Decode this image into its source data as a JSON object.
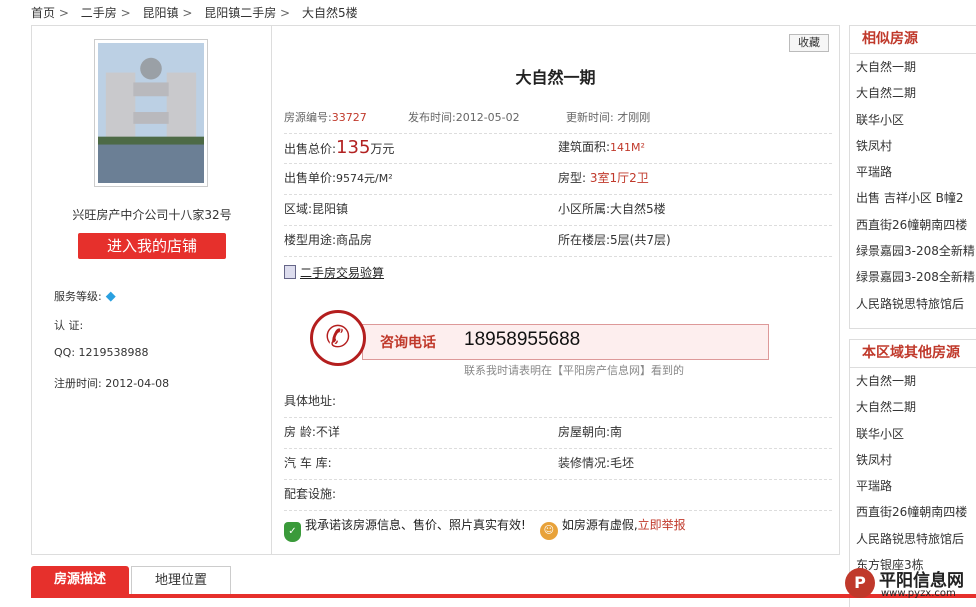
{
  "breadcrumb": [
    "首页",
    "二手房",
    "昆阳镇",
    "昆阳镇二手房",
    "大自然5楼"
  ],
  "breadcrumb_sep": ">",
  "agent": {
    "company": "兴旺房产中介公司十八家32号",
    "shop_button": "进入我的店铺",
    "service_label": "服务等级:",
    "cert_label": "认  证:",
    "qq_label": "QQ:",
    "qq": "1219538988",
    "reg_label": "注册时间:",
    "reg_date": "2012-04-08"
  },
  "listing": {
    "favorite": "收藏",
    "title": "大自然一期",
    "id_label": "房源编号:",
    "id": "33727",
    "publish_label": "发布时间:",
    "publish": "2012-05-02",
    "update_label": "更新时间:",
    "update": "才刚刚",
    "total_label": "出售总价:",
    "total": "135",
    "total_unit": "万元",
    "area_label": "建筑面积:",
    "area": "141M²",
    "unit_price_label": "出售单价:",
    "unit_price": "9574元/M²",
    "layout_label": "房型:",
    "layout": "3室1厅2卫",
    "region_label": "区域:",
    "region": "昆阳镇",
    "community_label": "小区所属:",
    "community": "大自然5楼",
    "use_label": "楼型用途:",
    "use": "商品房",
    "floor_label": "所在楼层:",
    "floor": "5层(共7层)",
    "calc": "二手房交易验算",
    "phone_label": "咨询电话",
    "phone": "18958955688",
    "phone_note": "联系我时请表明在【平阳房产信息网】看到的",
    "address_label": "具体地址:",
    "age_label": "房  龄:",
    "age": "不详",
    "facing_label": "房屋朝向:",
    "facing": "南",
    "garage_label": "汽 车 库:",
    "decor_label": "装修情况:",
    "decor": "毛坯",
    "facility_label": "配套设施:",
    "promise": "我承诺该房源信息、售价、照片真实有效!",
    "fake_text": "如房源有虚假,",
    "report": "立即举报"
  },
  "similar": {
    "title": "相似房源",
    "items": [
      "大自然一期",
      "大自然二期",
      "联华小区",
      "铁凤村",
      "平瑞路",
      "出售 吉祥小区 B幢2",
      "西直街26幢朝南四楼",
      "绿景嘉园3-208全新精",
      "绿景嘉园3-208全新精",
      "人民路锐思特旅馆后"
    ]
  },
  "region_other": {
    "title": "本区域其他房源",
    "items": [
      "大自然一期",
      "大自然二期",
      "联华小区",
      "铁凤村",
      "平瑞路",
      "西直街26幢朝南四楼",
      "人民路锐思特旅馆后",
      "东方银座3栋"
    ]
  },
  "tabs": [
    "房源描述",
    "地理位置"
  ],
  "watermark": {
    "name": "平阳信息网",
    "url": "www.pyzx.com"
  },
  "colors": {
    "accent": "#e6302c",
    "price": "#b22222"
  }
}
